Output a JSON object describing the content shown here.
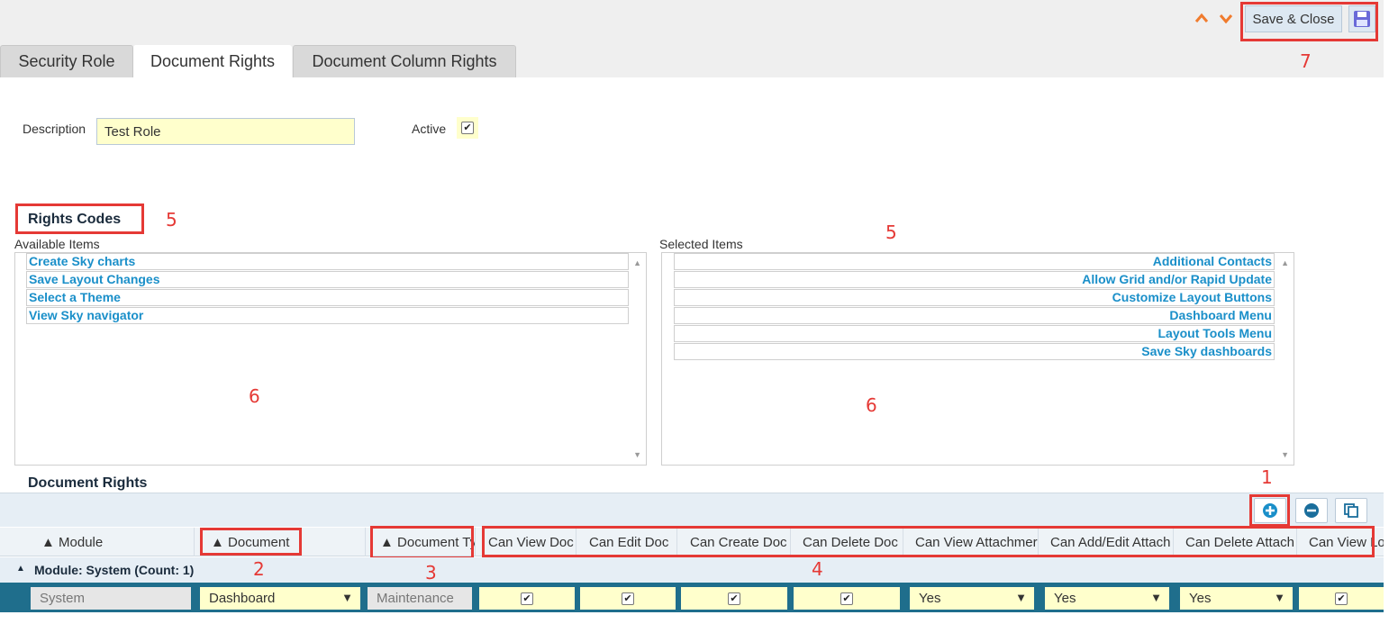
{
  "header": {
    "save_close_label": "Save & Close",
    "up_icon": "chevron-up-icon",
    "down_icon": "chevron-down-icon",
    "save_icon": "floppy-disk-icon",
    "accent_color": "#f07b2d"
  },
  "tabs": [
    {
      "label": "Security Role",
      "active": false
    },
    {
      "label": "Document Rights",
      "active": true
    },
    {
      "label": "Document Column Rights",
      "active": false
    }
  ],
  "form": {
    "description_label": "Description",
    "description_value": "Test Role",
    "active_label": "Active",
    "active_checked": true
  },
  "rights_codes": {
    "title": "Rights Codes",
    "available_label": "Available Items",
    "selected_label": "Selected Items",
    "available_items": [
      "Create Sky charts",
      "Save Layout Changes",
      "Select a Theme",
      "View Sky navigator"
    ],
    "selected_items": [
      "Additional Contacts",
      "Allow Grid and/or Rapid Update",
      "Customize Layout Buttons",
      "Dashboard Menu",
      "Layout Tools Menu",
      "Save Sky dashboards"
    ]
  },
  "document_rights": {
    "title": "Document Rights",
    "toolbar_icons": [
      "add-icon",
      "remove-icon",
      "copy-icon"
    ],
    "columns": [
      "▲ Module",
      "▲ Document",
      "▲ Document Ty",
      "Can View Doc",
      "Can Edit Doc",
      "Can Create Doc",
      "Can Delete Doc",
      "Can View Attachmer",
      "Can Add/Edit Attach",
      "Can Delete Attach",
      "Can View Lo"
    ],
    "group_label": "Module: System (Count: 1)",
    "row": {
      "module": "System",
      "document": "Dashboard",
      "document_type": "Maintenance",
      "can_view_doc": true,
      "can_edit_doc": true,
      "can_create_doc": true,
      "can_delete_doc": true,
      "can_view_attachments": "Yes",
      "can_add_edit_attach": "Yes",
      "can_delete_attach": "Yes",
      "can_view_log": true
    }
  },
  "annotations": [
    "1",
    "2",
    "3",
    "4",
    "5",
    "5",
    "6",
    "6",
    "7"
  ]
}
